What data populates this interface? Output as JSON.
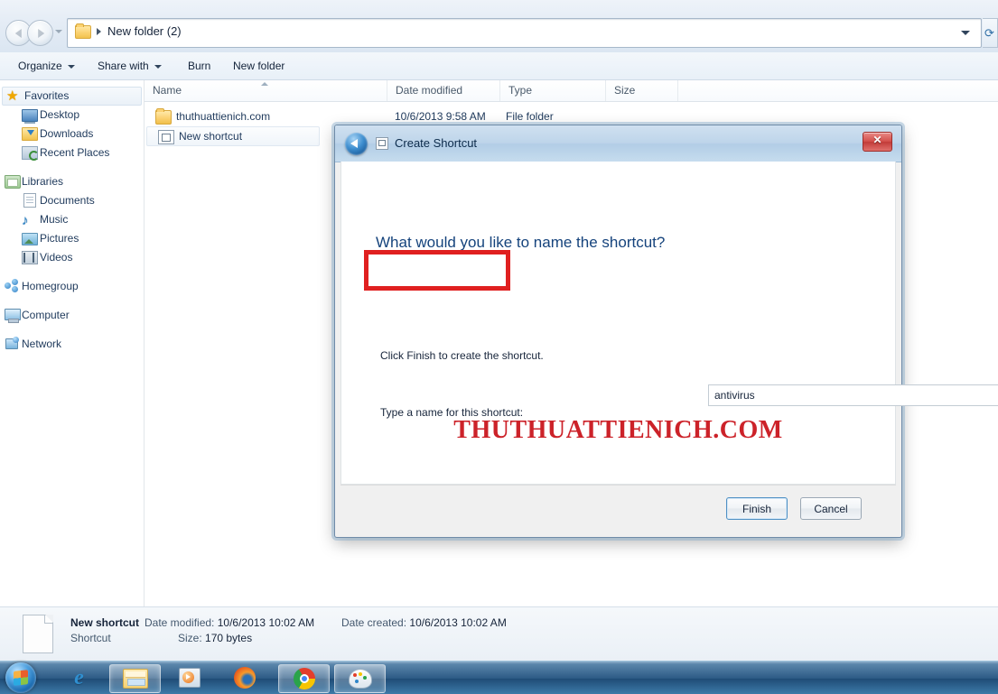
{
  "window": {
    "address": {
      "crumb": "New folder (2)",
      "folder_icon": "folder-icon",
      "caret": "chevron-down-icon"
    },
    "nav": {
      "back": "back-button",
      "forward": "forward-button",
      "recent": "recent-pages-dropdown",
      "refresh": "refresh-button"
    },
    "command_bar": [
      {
        "label": "Organize",
        "has_dropdown": true
      },
      {
        "label": "Share with",
        "has_dropdown": true
      },
      {
        "label": "Burn",
        "has_dropdown": false
      },
      {
        "label": "New folder",
        "has_dropdown": false
      }
    ]
  },
  "sidebar": {
    "groups": [
      {
        "root": {
          "label": "Favorites",
          "icon": "star-icon",
          "selected": true
        },
        "children": [
          {
            "label": "Desktop",
            "icon": "desktop-icon"
          },
          {
            "label": "Downloads",
            "icon": "downloads-icon"
          },
          {
            "label": "Recent Places",
            "icon": "recent-places-icon"
          }
        ]
      },
      {
        "root": {
          "label": "Libraries",
          "icon": "libraries-icon",
          "selected": false
        },
        "children": [
          {
            "label": "Documents",
            "icon": "documents-icon"
          },
          {
            "label": "Music",
            "icon": "music-icon"
          },
          {
            "label": "Pictures",
            "icon": "pictures-icon"
          },
          {
            "label": "Videos",
            "icon": "videos-icon"
          }
        ]
      },
      {
        "root": {
          "label": "Homegroup",
          "icon": "homegroup-icon",
          "selected": false
        },
        "children": []
      },
      {
        "root": {
          "label": "Computer",
          "icon": "computer-icon",
          "selected": false
        },
        "children": []
      },
      {
        "root": {
          "label": "Network",
          "icon": "network-icon",
          "selected": false
        },
        "children": []
      }
    ]
  },
  "file_list": {
    "columns": [
      {
        "label": "Name",
        "sorted": true,
        "sort_direction": "ascending"
      },
      {
        "label": "Date modified"
      },
      {
        "label": "Type"
      },
      {
        "label": "Size"
      }
    ],
    "rows": [
      {
        "name": "thuthuattienich.com",
        "icon": "folder-icon",
        "date_modified": "10/6/2013 9:58 AM",
        "type": "File folder",
        "size": "",
        "selected": false
      },
      {
        "name": "New shortcut",
        "icon": "shortcut-icon",
        "date_modified": "",
        "type": "",
        "size": "",
        "selected": true
      }
    ]
  },
  "details_pane": {
    "icon": "file-icon",
    "name": "New shortcut",
    "type": "Shortcut",
    "date_modified_label": "Date modified:",
    "date_modified_value": "10/6/2013 10:02 AM",
    "size_label": "Size:",
    "size_value": "170 bytes",
    "date_created_label": "Date created:",
    "date_created_value": "10/6/2013 10:02 AM"
  },
  "dialog": {
    "title": "Create Shortcut",
    "back_button": "back-button",
    "close_button": "✕",
    "heading": "What would you like to name the shortcut?",
    "field_label": "Type a name for this shortcut:",
    "input_value": "antivirus",
    "input_placeholder": "",
    "hint": "Click Finish to create the shortcut.",
    "buttons": {
      "finish": "Finish",
      "cancel": "Cancel"
    }
  },
  "watermark": {
    "text": "THUTHUATTIENICH.COM",
    "color": "#cc2229"
  },
  "annotation": {
    "color": "#e02020",
    "target": "shortcut-name-input"
  },
  "taskbar": {
    "start": "windows-start-orb",
    "items": [
      {
        "name": "internet-explorer",
        "pinned": true,
        "running": false
      },
      {
        "name": "windows-explorer",
        "pinned": true,
        "running": true
      },
      {
        "name": "windows-media-player",
        "pinned": true,
        "running": false
      },
      {
        "name": "firefox",
        "pinned": true,
        "running": false
      },
      {
        "name": "google-chrome",
        "pinned": true,
        "running": true
      },
      {
        "name": "paint",
        "pinned": true,
        "running": true
      }
    ]
  }
}
